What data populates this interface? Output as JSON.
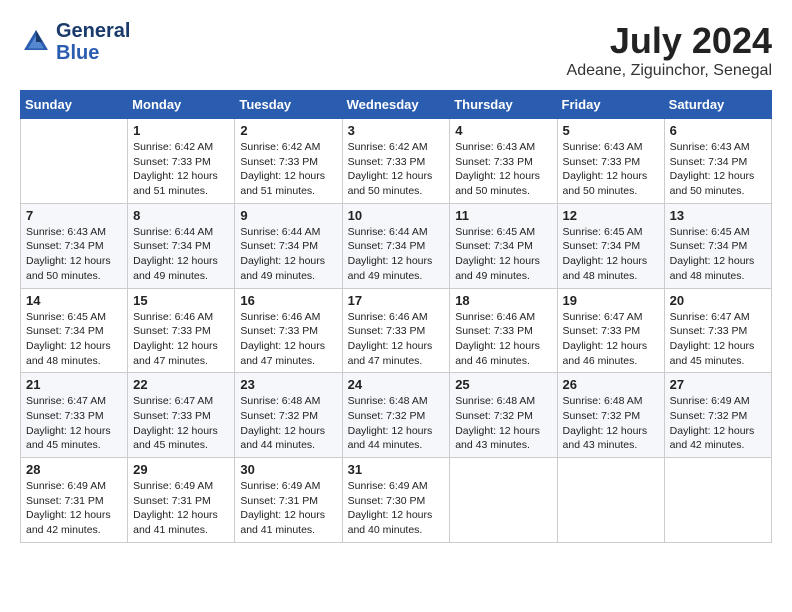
{
  "header": {
    "logo_line1": "General",
    "logo_line2": "Blue",
    "month_year": "July 2024",
    "location": "Adeane, Ziguinchor, Senegal"
  },
  "weekdays": [
    "Sunday",
    "Monday",
    "Tuesday",
    "Wednesday",
    "Thursday",
    "Friday",
    "Saturday"
  ],
  "weeks": [
    [
      {
        "day": "",
        "info": ""
      },
      {
        "day": "1",
        "info": "Sunrise: 6:42 AM\nSunset: 7:33 PM\nDaylight: 12 hours\nand 51 minutes."
      },
      {
        "day": "2",
        "info": "Sunrise: 6:42 AM\nSunset: 7:33 PM\nDaylight: 12 hours\nand 51 minutes."
      },
      {
        "day": "3",
        "info": "Sunrise: 6:42 AM\nSunset: 7:33 PM\nDaylight: 12 hours\nand 50 minutes."
      },
      {
        "day": "4",
        "info": "Sunrise: 6:43 AM\nSunset: 7:33 PM\nDaylight: 12 hours\nand 50 minutes."
      },
      {
        "day": "5",
        "info": "Sunrise: 6:43 AM\nSunset: 7:33 PM\nDaylight: 12 hours\nand 50 minutes."
      },
      {
        "day": "6",
        "info": "Sunrise: 6:43 AM\nSunset: 7:34 PM\nDaylight: 12 hours\nand 50 minutes."
      }
    ],
    [
      {
        "day": "7",
        "info": "Sunrise: 6:43 AM\nSunset: 7:34 PM\nDaylight: 12 hours\nand 50 minutes."
      },
      {
        "day": "8",
        "info": "Sunrise: 6:44 AM\nSunset: 7:34 PM\nDaylight: 12 hours\nand 49 minutes."
      },
      {
        "day": "9",
        "info": "Sunrise: 6:44 AM\nSunset: 7:34 PM\nDaylight: 12 hours\nand 49 minutes."
      },
      {
        "day": "10",
        "info": "Sunrise: 6:44 AM\nSunset: 7:34 PM\nDaylight: 12 hours\nand 49 minutes."
      },
      {
        "day": "11",
        "info": "Sunrise: 6:45 AM\nSunset: 7:34 PM\nDaylight: 12 hours\nand 49 minutes."
      },
      {
        "day": "12",
        "info": "Sunrise: 6:45 AM\nSunset: 7:34 PM\nDaylight: 12 hours\nand 48 minutes."
      },
      {
        "day": "13",
        "info": "Sunrise: 6:45 AM\nSunset: 7:34 PM\nDaylight: 12 hours\nand 48 minutes."
      }
    ],
    [
      {
        "day": "14",
        "info": "Sunrise: 6:45 AM\nSunset: 7:34 PM\nDaylight: 12 hours\nand 48 minutes."
      },
      {
        "day": "15",
        "info": "Sunrise: 6:46 AM\nSunset: 7:33 PM\nDaylight: 12 hours\nand 47 minutes."
      },
      {
        "day": "16",
        "info": "Sunrise: 6:46 AM\nSunset: 7:33 PM\nDaylight: 12 hours\nand 47 minutes."
      },
      {
        "day": "17",
        "info": "Sunrise: 6:46 AM\nSunset: 7:33 PM\nDaylight: 12 hours\nand 47 minutes."
      },
      {
        "day": "18",
        "info": "Sunrise: 6:46 AM\nSunset: 7:33 PM\nDaylight: 12 hours\nand 46 minutes."
      },
      {
        "day": "19",
        "info": "Sunrise: 6:47 AM\nSunset: 7:33 PM\nDaylight: 12 hours\nand 46 minutes."
      },
      {
        "day": "20",
        "info": "Sunrise: 6:47 AM\nSunset: 7:33 PM\nDaylight: 12 hours\nand 45 minutes."
      }
    ],
    [
      {
        "day": "21",
        "info": "Sunrise: 6:47 AM\nSunset: 7:33 PM\nDaylight: 12 hours\nand 45 minutes."
      },
      {
        "day": "22",
        "info": "Sunrise: 6:47 AM\nSunset: 7:33 PM\nDaylight: 12 hours\nand 45 minutes."
      },
      {
        "day": "23",
        "info": "Sunrise: 6:48 AM\nSunset: 7:32 PM\nDaylight: 12 hours\nand 44 minutes."
      },
      {
        "day": "24",
        "info": "Sunrise: 6:48 AM\nSunset: 7:32 PM\nDaylight: 12 hours\nand 44 minutes."
      },
      {
        "day": "25",
        "info": "Sunrise: 6:48 AM\nSunset: 7:32 PM\nDaylight: 12 hours\nand 43 minutes."
      },
      {
        "day": "26",
        "info": "Sunrise: 6:48 AM\nSunset: 7:32 PM\nDaylight: 12 hours\nand 43 minutes."
      },
      {
        "day": "27",
        "info": "Sunrise: 6:49 AM\nSunset: 7:32 PM\nDaylight: 12 hours\nand 42 minutes."
      }
    ],
    [
      {
        "day": "28",
        "info": "Sunrise: 6:49 AM\nSunset: 7:31 PM\nDaylight: 12 hours\nand 42 minutes."
      },
      {
        "day": "29",
        "info": "Sunrise: 6:49 AM\nSunset: 7:31 PM\nDaylight: 12 hours\nand 41 minutes."
      },
      {
        "day": "30",
        "info": "Sunrise: 6:49 AM\nSunset: 7:31 PM\nDaylight: 12 hours\nand 41 minutes."
      },
      {
        "day": "31",
        "info": "Sunrise: 6:49 AM\nSunset: 7:30 PM\nDaylight: 12 hours\nand 40 minutes."
      },
      {
        "day": "",
        "info": ""
      },
      {
        "day": "",
        "info": ""
      },
      {
        "day": "",
        "info": ""
      }
    ]
  ]
}
